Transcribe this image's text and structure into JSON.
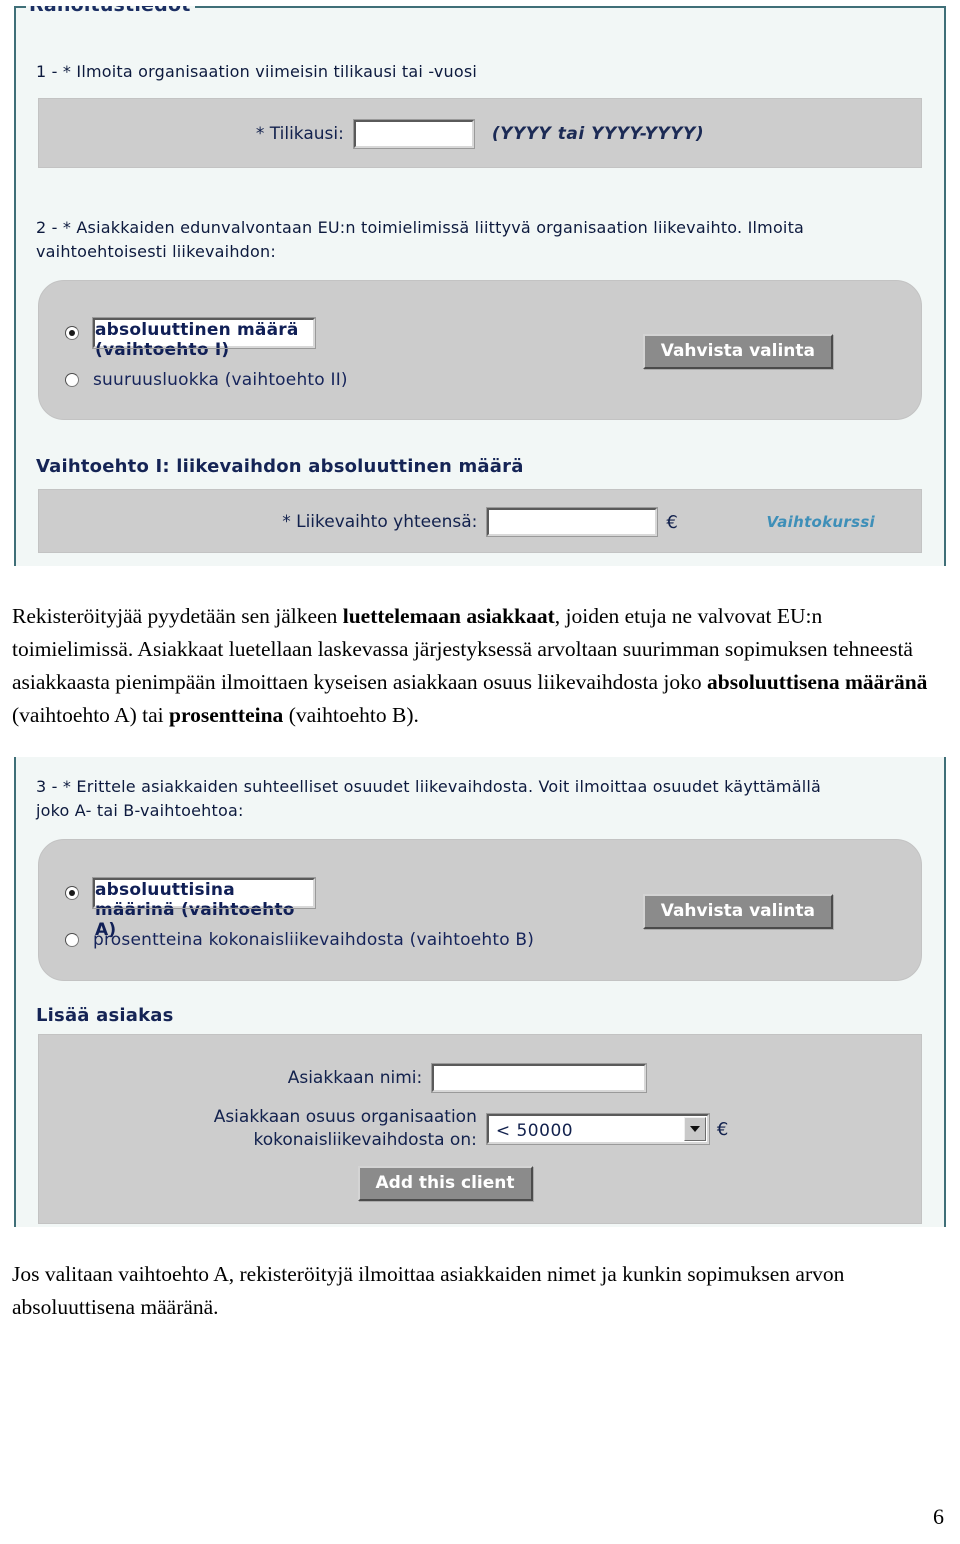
{
  "document": {
    "page_number": "6"
  },
  "screenshot_top": {
    "legend": "Rahoitustiedot",
    "q1": {
      "text": "1 - * Ilmoita organisaation viimeisin tilikausi tai -vuosi",
      "field_label": "* Tilikausi:",
      "field_value": "",
      "hint": "(YYYY tai YYYY-YYYY)"
    },
    "q2": {
      "text_line1": "2 - * Asiakkaiden edunvalvontaan EU:n toimielimissä liittyvä organisaation liikevaihto. Ilmoita",
      "text_line2": "vaihtoehtoisesti liikevaihdon:",
      "option1": "absoluuttinen määrä (vaihtoehto I)",
      "option2": "suuruusluokka (vaihtoehto II)",
      "selected_index": 0,
      "confirm_button": "Vahvista valinta"
    },
    "option_i": {
      "heading": "Vaihtoehto I: liikevaihdon absoluuttinen määrä",
      "field_label": "* Liikevaihto yhteensä:",
      "field_value": "",
      "currency": "€",
      "link": "Vaihtokurssi"
    }
  },
  "paragraph_middle": {
    "part1": "Rekisteröityjää pyydetään sen jälkeen ",
    "bold1": "luettelemaan asiakkaat",
    "part2": ", joiden etuja ne valvovat EU:n toimielimissä. Asiakkaat luetellaan laskevassa järjestyksessä arvoltaan suurimman sopimuksen tehneestä asiakkaasta pienimpään ilmoittaen kyseisen asiakkaan osuus liikevaihdosta joko ",
    "bold2": "absoluuttisena määränä",
    "part3": " (vaihtoehto A) tai ",
    "bold3": "prosentteina",
    "part4": " (vaihtoehto B)."
  },
  "screenshot_bottom": {
    "q3": {
      "text_line1": "3 - * Erittele asiakkaiden suhteelliset osuudet liikevaihdosta. Voit ilmoittaa osuudet käyttämällä",
      "text_line2": "joko A- tai B-vaihtoehtoa:",
      "option1": "absoluuttisina määrinä (vaihtoehto A)",
      "option2": "prosentteina kokonaisliikevaihdosta (vaihtoehto B)",
      "selected_index": 0,
      "confirm_button": "Vahvista valinta"
    },
    "add_client": {
      "heading": "Lisää asiakas",
      "name_label": "Asiakkaan nimi:",
      "name_value": "",
      "share_label_line1": "Asiakkaan osuus organisaation",
      "share_label_line2": "kokonaisliikevaihdosta on:",
      "share_value": "< 50000",
      "currency": "€",
      "add_button": "Add this client"
    }
  },
  "paragraph_bottom": {
    "text": "Jos valitaan vaihtoehto A, rekisteröityjä ilmoittaa asiakkaiden nimet ja kunkin sopimuksen arvon absoluuttisena määränä."
  }
}
